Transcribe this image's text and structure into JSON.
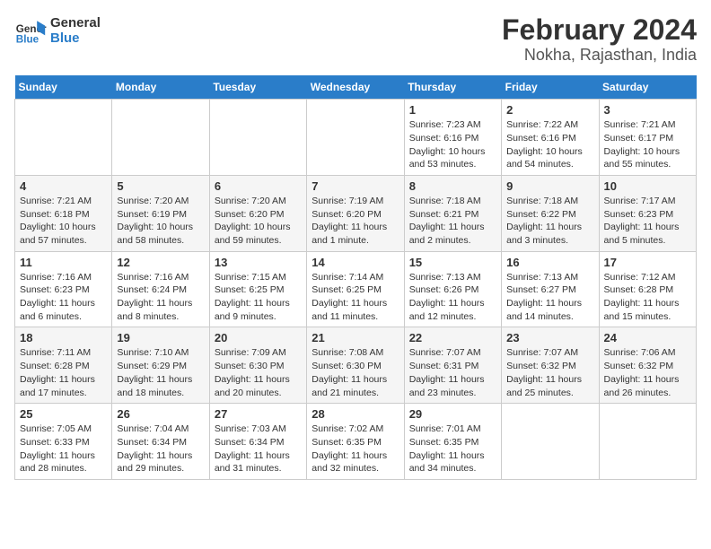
{
  "logo": {
    "line1": "General",
    "line2": "Blue"
  },
  "title": "February 2024",
  "subtitle": "Nokha, Rajasthan, India",
  "headers": [
    "Sunday",
    "Monday",
    "Tuesday",
    "Wednesday",
    "Thursday",
    "Friday",
    "Saturday"
  ],
  "weeks": [
    [
      {
        "day": "",
        "info": ""
      },
      {
        "day": "",
        "info": ""
      },
      {
        "day": "",
        "info": ""
      },
      {
        "day": "",
        "info": ""
      },
      {
        "day": "1",
        "info": "Sunrise: 7:23 AM\nSunset: 6:16 PM\nDaylight: 10 hours\nand 53 minutes."
      },
      {
        "day": "2",
        "info": "Sunrise: 7:22 AM\nSunset: 6:16 PM\nDaylight: 10 hours\nand 54 minutes."
      },
      {
        "day": "3",
        "info": "Sunrise: 7:21 AM\nSunset: 6:17 PM\nDaylight: 10 hours\nand 55 minutes."
      }
    ],
    [
      {
        "day": "4",
        "info": "Sunrise: 7:21 AM\nSunset: 6:18 PM\nDaylight: 10 hours\nand 57 minutes."
      },
      {
        "day": "5",
        "info": "Sunrise: 7:20 AM\nSunset: 6:19 PM\nDaylight: 10 hours\nand 58 minutes."
      },
      {
        "day": "6",
        "info": "Sunrise: 7:20 AM\nSunset: 6:20 PM\nDaylight: 10 hours\nand 59 minutes."
      },
      {
        "day": "7",
        "info": "Sunrise: 7:19 AM\nSunset: 6:20 PM\nDaylight: 11 hours\nand 1 minute."
      },
      {
        "day": "8",
        "info": "Sunrise: 7:18 AM\nSunset: 6:21 PM\nDaylight: 11 hours\nand 2 minutes."
      },
      {
        "day": "9",
        "info": "Sunrise: 7:18 AM\nSunset: 6:22 PM\nDaylight: 11 hours\nand 3 minutes."
      },
      {
        "day": "10",
        "info": "Sunrise: 7:17 AM\nSunset: 6:23 PM\nDaylight: 11 hours\nand 5 minutes."
      }
    ],
    [
      {
        "day": "11",
        "info": "Sunrise: 7:16 AM\nSunset: 6:23 PM\nDaylight: 11 hours\nand 6 minutes."
      },
      {
        "day": "12",
        "info": "Sunrise: 7:16 AM\nSunset: 6:24 PM\nDaylight: 11 hours\nand 8 minutes."
      },
      {
        "day": "13",
        "info": "Sunrise: 7:15 AM\nSunset: 6:25 PM\nDaylight: 11 hours\nand 9 minutes."
      },
      {
        "day": "14",
        "info": "Sunrise: 7:14 AM\nSunset: 6:25 PM\nDaylight: 11 hours\nand 11 minutes."
      },
      {
        "day": "15",
        "info": "Sunrise: 7:13 AM\nSunset: 6:26 PM\nDaylight: 11 hours\nand 12 minutes."
      },
      {
        "day": "16",
        "info": "Sunrise: 7:13 AM\nSunset: 6:27 PM\nDaylight: 11 hours\nand 14 minutes."
      },
      {
        "day": "17",
        "info": "Sunrise: 7:12 AM\nSunset: 6:28 PM\nDaylight: 11 hours\nand 15 minutes."
      }
    ],
    [
      {
        "day": "18",
        "info": "Sunrise: 7:11 AM\nSunset: 6:28 PM\nDaylight: 11 hours\nand 17 minutes."
      },
      {
        "day": "19",
        "info": "Sunrise: 7:10 AM\nSunset: 6:29 PM\nDaylight: 11 hours\nand 18 minutes."
      },
      {
        "day": "20",
        "info": "Sunrise: 7:09 AM\nSunset: 6:30 PM\nDaylight: 11 hours\nand 20 minutes."
      },
      {
        "day": "21",
        "info": "Sunrise: 7:08 AM\nSunset: 6:30 PM\nDaylight: 11 hours\nand 21 minutes."
      },
      {
        "day": "22",
        "info": "Sunrise: 7:07 AM\nSunset: 6:31 PM\nDaylight: 11 hours\nand 23 minutes."
      },
      {
        "day": "23",
        "info": "Sunrise: 7:07 AM\nSunset: 6:32 PM\nDaylight: 11 hours\nand 25 minutes."
      },
      {
        "day": "24",
        "info": "Sunrise: 7:06 AM\nSunset: 6:32 PM\nDaylight: 11 hours\nand 26 minutes."
      }
    ],
    [
      {
        "day": "25",
        "info": "Sunrise: 7:05 AM\nSunset: 6:33 PM\nDaylight: 11 hours\nand 28 minutes."
      },
      {
        "day": "26",
        "info": "Sunrise: 7:04 AM\nSunset: 6:34 PM\nDaylight: 11 hours\nand 29 minutes."
      },
      {
        "day": "27",
        "info": "Sunrise: 7:03 AM\nSunset: 6:34 PM\nDaylight: 11 hours\nand 31 minutes."
      },
      {
        "day": "28",
        "info": "Sunrise: 7:02 AM\nSunset: 6:35 PM\nDaylight: 11 hours\nand 32 minutes."
      },
      {
        "day": "29",
        "info": "Sunrise: 7:01 AM\nSunset: 6:35 PM\nDaylight: 11 hours\nand 34 minutes."
      },
      {
        "day": "",
        "info": ""
      },
      {
        "day": "",
        "info": ""
      }
    ]
  ]
}
